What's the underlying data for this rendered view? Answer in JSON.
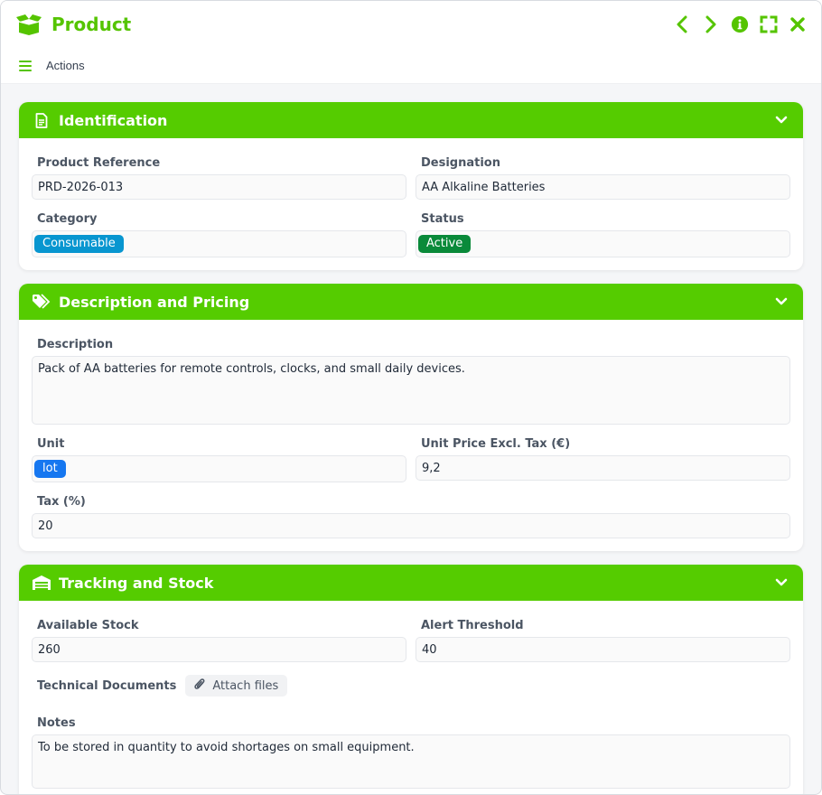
{
  "window": {
    "title": "Product",
    "icon": "box-icon",
    "controls": [
      "chevron-left-icon",
      "chevron-right-icon",
      "info-icon",
      "fullscreen-icon",
      "close-icon"
    ]
  },
  "actionsbar": {
    "label": "Actions"
  },
  "colors": {
    "accent": "#55cc00",
    "title": "#55c400",
    "category_badge": "#0896d0",
    "status_badge": "#0a8a3a",
    "unit_badge": "#1677f0"
  },
  "sections": {
    "identification": {
      "title": "Identification",
      "icon": "document-icon",
      "product_reference": {
        "label": "Product Reference",
        "value": "PRD-2026-013"
      },
      "designation": {
        "label": "Designation",
        "value": "AA Alkaline Batteries"
      },
      "category": {
        "label": "Category",
        "value": "Consumable"
      },
      "status": {
        "label": "Status",
        "value": "Active"
      }
    },
    "description_pricing": {
      "title": "Description and Pricing",
      "icon": "tags-icon",
      "description": {
        "label": "Description",
        "value": "Pack of AA batteries for remote controls, clocks, and small daily devices."
      },
      "unit": {
        "label": "Unit",
        "value": "lot"
      },
      "unit_price": {
        "label": "Unit Price Excl. Tax (€)",
        "value": "9,2"
      },
      "tax": {
        "label": "Tax (%)",
        "value": "20"
      }
    },
    "tracking_stock": {
      "title": "Tracking and Stock",
      "icon": "warehouse-icon",
      "available_stock": {
        "label": "Available Stock",
        "value": "260"
      },
      "alert_threshold": {
        "label": "Alert Threshold",
        "value": "40"
      },
      "technical_documents": {
        "label": "Technical Documents",
        "button": "Attach files"
      },
      "notes": {
        "label": "Notes",
        "value": "To be stored in quantity to avoid shortages on small equipment."
      }
    }
  }
}
